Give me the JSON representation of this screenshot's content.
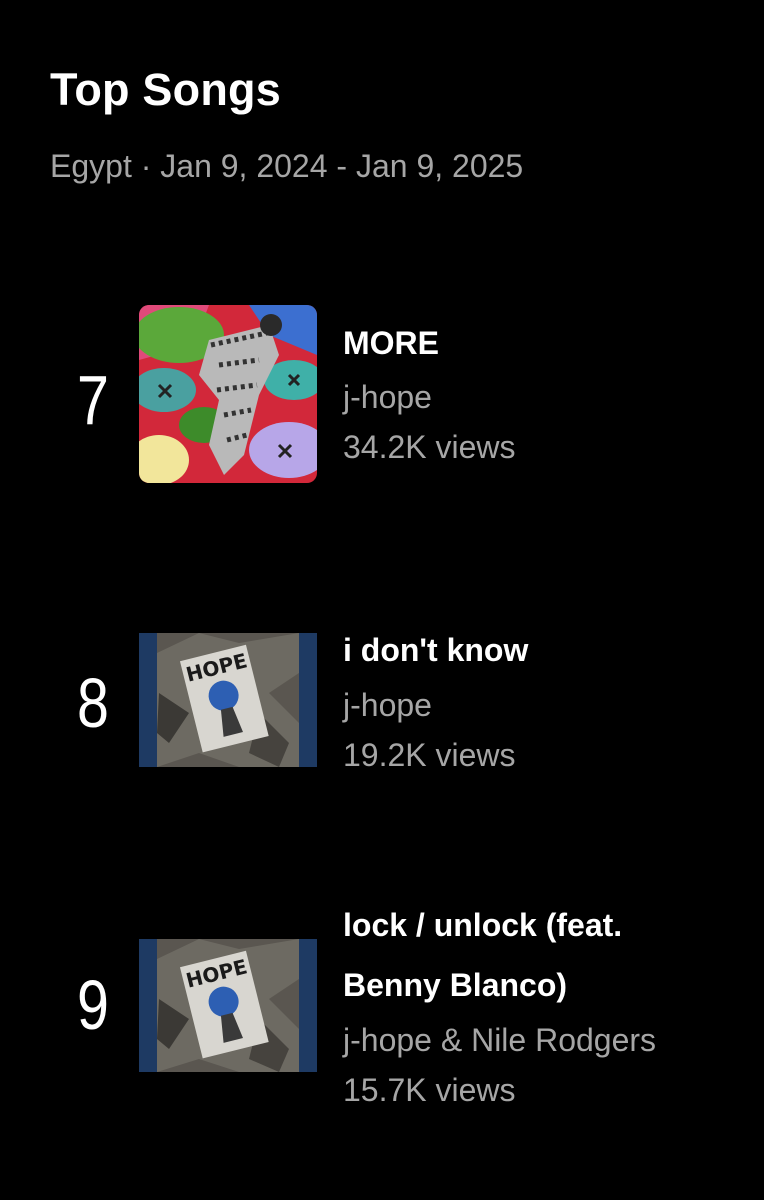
{
  "header": {
    "title": "Top Songs",
    "subtitle": "Egypt · Jan 9, 2024 - Jan 9, 2025"
  },
  "songs": [
    {
      "rank": "7",
      "title": "MORE",
      "artist": "j-hope",
      "views": "34.2K views",
      "thumbnail": "more-album-art"
    },
    {
      "rank": "8",
      "title": "i don't know",
      "artist": "j-hope",
      "views": "19.2K views",
      "thumbnail": "hope-on-the-street-album-art"
    },
    {
      "rank": "9",
      "title_line1": "lock / unlock (feat.",
      "title_line2": "Benny Blanco)",
      "artist": "j-hope & Nile Rodgers",
      "views": "15.7K views",
      "thumbnail": "hope-on-the-street-album-art"
    }
  ],
  "colors": {
    "background": "#000000",
    "primary_text": "#ffffff",
    "secondary_text": "#a6a6a6",
    "album_border_blue": "#1e3a63"
  }
}
